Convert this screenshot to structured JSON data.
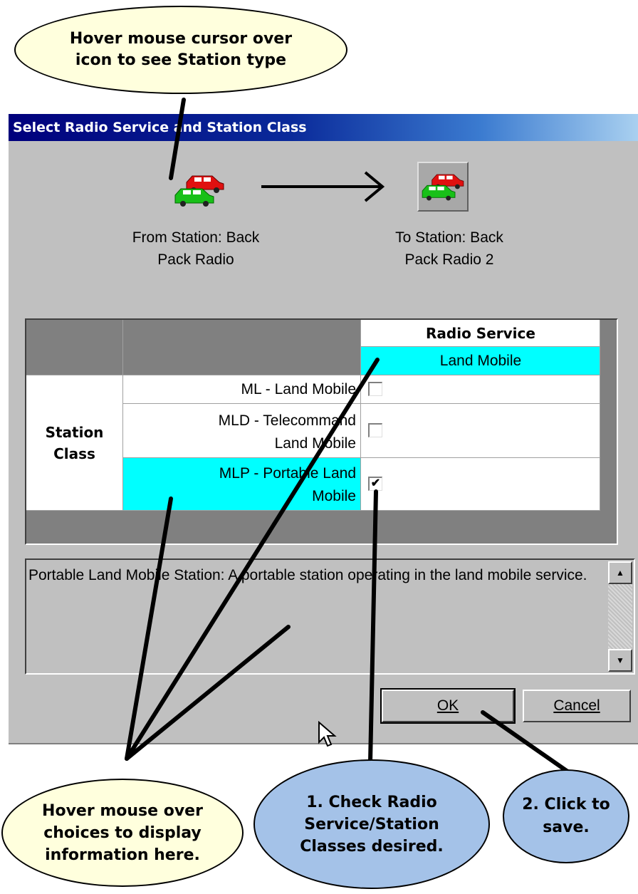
{
  "callouts": {
    "top": "Hover mouse cursor over\nicon to see Station type",
    "hover_choices": "Hover mouse over\nchoices to display\ninformation here.",
    "check": "1.  Check Radio\nService/Station\nClasses desired.",
    "click": "2. Click to\nsave."
  },
  "colors": {
    "callout_yellow": "#ffffdd",
    "callout_blue": "#a4c2e8",
    "highlight_cyan": "#00ffff"
  },
  "dialog": {
    "title": "Select Radio Service and Station Class",
    "from_icon": "cars-icon",
    "to_icon": "cars-icon",
    "from_station": "From Station: Back\nPack Radio",
    "to_station": "To Station: Back\nPack Radio 2",
    "grid": {
      "column_header": "Radio Service",
      "service": "Land Mobile",
      "row_group_label": "Station\nClass",
      "rows": [
        {
          "label": "ML - Land Mobile",
          "checked": false
        },
        {
          "label": "MLD - Telecommand\nLand Mobile",
          "checked": false
        },
        {
          "label": "MLP - Portable Land\nMobile",
          "checked": true
        }
      ]
    },
    "description": "Portable Land Mobile Station: A portable station operating in the land mobile service.",
    "buttons": {
      "ok": "OK",
      "cancel": "Cancel"
    }
  }
}
